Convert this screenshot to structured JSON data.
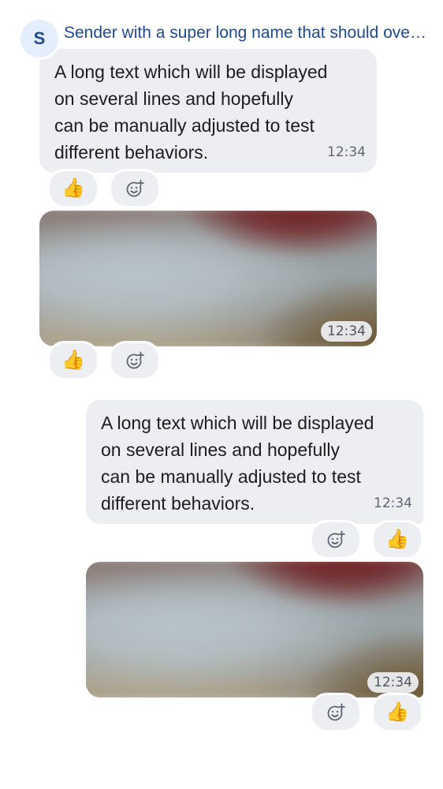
{
  "sender": {
    "avatar_initial": "S",
    "name": "Sender with a super long name that should overflow the available width"
  },
  "messages": {
    "incoming_text": {
      "text": "A long text which will be displayed\non several lines and hopefully\ncan be manually adjusted to test\ndifferent behaviors.",
      "time": "12:34"
    },
    "incoming_image": {
      "time": "12:34"
    },
    "outgoing_text": {
      "text": "A long text which will be displayed\non several lines and hopefully\ncan be manually adjusted to test\ndifferent behaviors.",
      "time": "12:34"
    },
    "outgoing_image": {
      "time": "12:34"
    }
  },
  "reactions": {
    "emoji": "👍",
    "add_reaction_icon": "add-reaction-icon",
    "colors": {
      "chip_bg": "#eceef2",
      "accent": "#1f4a92",
      "bubble_bg": "#eceef2"
    }
  }
}
